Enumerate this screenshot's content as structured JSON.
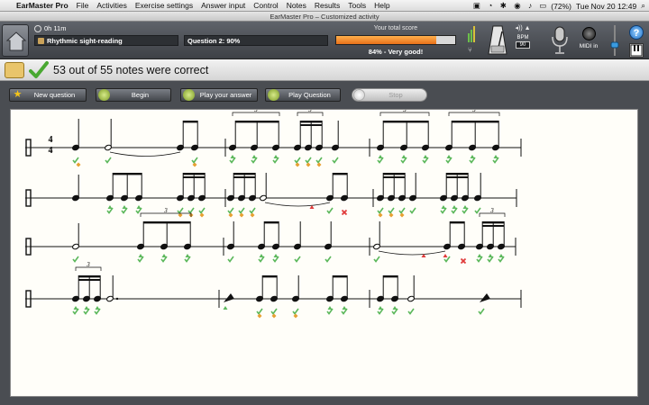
{
  "menubar": {
    "apple": "",
    "app_name": "EarMaster Pro",
    "items": [
      "File",
      "Activities",
      "Exercise settings",
      "Answer input",
      "Control",
      "Notes",
      "Results",
      "Tools",
      "Help"
    ],
    "battery": "(72%)",
    "clock": "Tue Nov 20  12:49"
  },
  "window": {
    "title": "EarMaster Pro – Customized activity"
  },
  "toolbar": {
    "timer": "0h 11m",
    "activity": "Rhythmic sight-reading",
    "question": "Question 2: 90%",
    "score_label": "Your total score",
    "score_percent": 84,
    "score_text": "84% - Very good!",
    "bpm_label": "BPM",
    "bpm_value": "90",
    "midi_label": "MIDI in",
    "help_glyph": "?"
  },
  "result": {
    "text": "53 out of 55 notes were correct"
  },
  "actions": {
    "new_question": "New question",
    "begin": "Begin",
    "play_answer": "Play your answer",
    "play_question": "Play Question",
    "stop": "Stop"
  },
  "colors": {
    "correct": "#5cb85c",
    "early_late": "#e7a032",
    "miss": "#e03b3b",
    "score_fill": "#f28a2c"
  }
}
